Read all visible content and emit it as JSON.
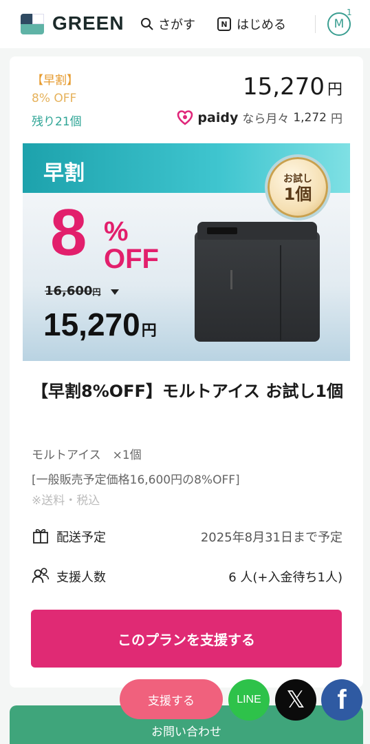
{
  "header": {
    "logo_text": "GREEN",
    "search_label": "さがす",
    "start_label": "はじめる",
    "start_icon_letter": "N",
    "avatar_letter": "M",
    "avatar_badge": "1"
  },
  "plan": {
    "tag_early": "【早割】",
    "tag_discount": "8% OFF",
    "tag_remaining": "残り21個",
    "price": "15,270",
    "price_unit": "円",
    "paidy_logo": "paidy",
    "paidy_text": "なら月々",
    "paidy_amount": "1,272",
    "paidy_unit": "円"
  },
  "banner": {
    "title": "早割",
    "big_number": "8",
    "percent": "%",
    "off": "OFF",
    "old_price": "16,600",
    "old_price_unit": "円",
    "new_price": "15,270",
    "new_price_unit": "円",
    "medal_line1": "お試し",
    "medal_line2": "1個"
  },
  "product": {
    "title": "【早割8%OFF】モルトアイス お試し1個",
    "item_line": "モルトアイス　×1個",
    "note_line": "[一般販売予定価格16,600円の8%OFF]",
    "shipping_note": "※送料・税込"
  },
  "details": {
    "delivery_label": "配送予定",
    "delivery_value": "2025年8月31日まで予定",
    "supporters_label": "支援人数",
    "supporters_value": "6 人(+入金待ち1人)"
  },
  "cta": {
    "support_plan_label": "このプランを支援する"
  },
  "bottom_bar": {
    "float_support_label": "支援する",
    "line_label": "LINE",
    "x_label": "𝕏",
    "fb_label": "f",
    "contact_label": "お問い合わせ"
  },
  "colors": {
    "brand_green": "#3fa57b",
    "cta_pink": "#e02a74",
    "teal": "#2fa596",
    "orange": "#e69a2d"
  }
}
